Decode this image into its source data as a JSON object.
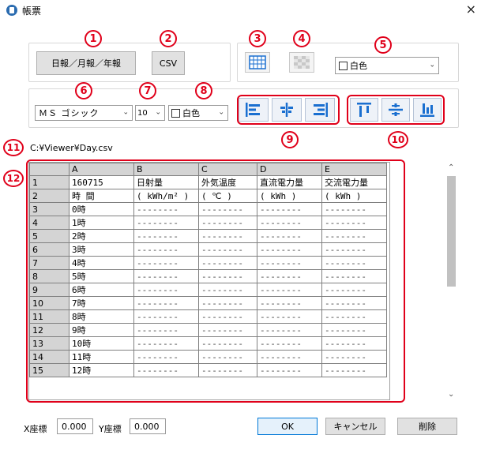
{
  "window": {
    "title": "帳票",
    "close": "×"
  },
  "toolbar": {
    "report_button": "日報／月報／年報",
    "csv_button": "CSV",
    "bg_color": "白色",
    "font_name": "ＭＳ ゴシック",
    "font_size": "10",
    "font_color": "白色"
  },
  "badges": [
    "1",
    "2",
    "3",
    "4",
    "5",
    "6",
    "7",
    "8",
    "9",
    "10",
    "11",
    "12"
  ],
  "file_path": "C:¥Viewer¥Day.csv",
  "grid": {
    "columns": [
      "A",
      "B",
      "C",
      "D",
      "E"
    ],
    "rows": [
      {
        "n": "1",
        "cells": [
          "160715",
          "日射量",
          "外気温度",
          "直流電力量",
          "交流電力量"
        ]
      },
      {
        "n": "2",
        "cells": [
          "時 間",
          "( kWh/m² )",
          "( ℃ )",
          "( kWh )",
          "( kWh )"
        ]
      },
      {
        "n": "3",
        "cells": [
          "0時",
          "--------",
          "--------",
          "--------",
          "--------"
        ]
      },
      {
        "n": "4",
        "cells": [
          "1時",
          "--------",
          "--------",
          "--------",
          "--------"
        ]
      },
      {
        "n": "5",
        "cells": [
          "2時",
          "--------",
          "--------",
          "--------",
          "--------"
        ]
      },
      {
        "n": "6",
        "cells": [
          "3時",
          "--------",
          "--------",
          "--------",
          "--------"
        ]
      },
      {
        "n": "7",
        "cells": [
          "4時",
          "--------",
          "--------",
          "--------",
          "--------"
        ]
      },
      {
        "n": "8",
        "cells": [
          "5時",
          "--------",
          "--------",
          "--------",
          "--------"
        ]
      },
      {
        "n": "9",
        "cells": [
          "6時",
          "--------",
          "--------",
          "--------",
          "--------"
        ]
      },
      {
        "n": "10",
        "cells": [
          "7時",
          "--------",
          "--------",
          "--------",
          "--------"
        ]
      },
      {
        "n": "11",
        "cells": [
          "8時",
          "--------",
          "--------",
          "--------",
          "--------"
        ]
      },
      {
        "n": "12",
        "cells": [
          "9時",
          "--------",
          "--------",
          "--------",
          "--------"
        ]
      },
      {
        "n": "13",
        "cells": [
          "10時",
          "--------",
          "--------",
          "--------",
          "--------"
        ]
      },
      {
        "n": "14",
        "cells": [
          "11時",
          "--------",
          "--------",
          "--------",
          "--------"
        ]
      },
      {
        "n": "15",
        "cells": [
          "12時",
          "--------",
          "--------",
          "--------",
          "--------"
        ]
      }
    ]
  },
  "footer": {
    "x_label": "X座標",
    "x_value": "0.000",
    "y_label": "Y座標",
    "y_value": "0.000",
    "ok": "OK",
    "cancel": "キャンセル",
    "delete": "削除"
  },
  "colors": {
    "annotation_red": "#e0001a",
    "icon_blue": "#1a6fd0"
  }
}
